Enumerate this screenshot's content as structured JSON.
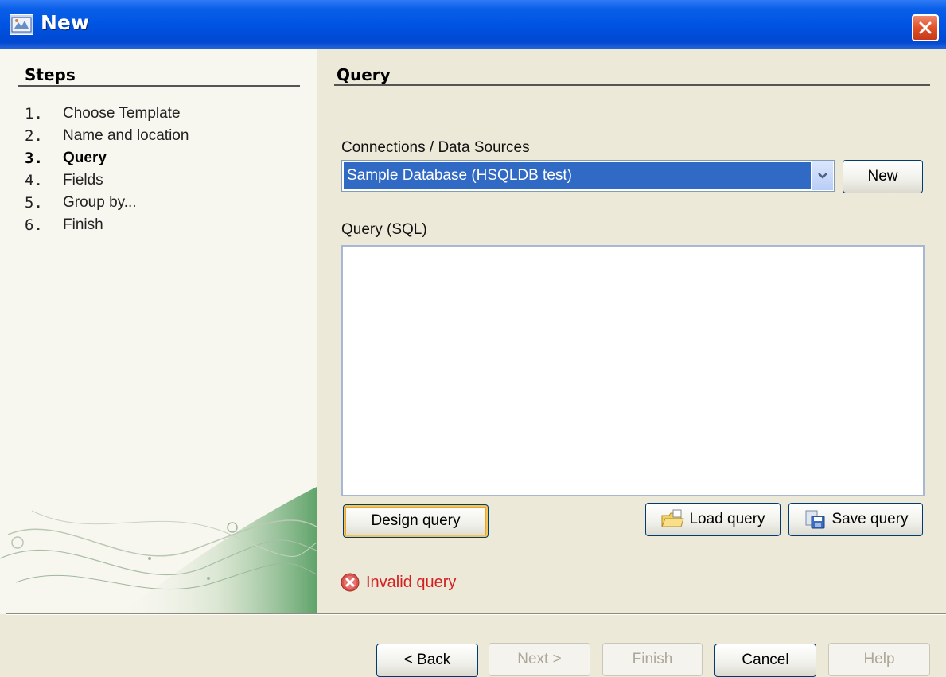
{
  "window": {
    "title": "New",
    "icon": "report-wizard-icon"
  },
  "steps": {
    "heading": "Steps",
    "items": [
      {
        "number": "1.",
        "label": "Choose Template",
        "current": false
      },
      {
        "number": "2.",
        "label": "Name and location",
        "current": false
      },
      {
        "number": "3.",
        "label": "Query",
        "current": true
      },
      {
        "number": "4.",
        "label": "Fields",
        "current": false
      },
      {
        "number": "5.",
        "label": "Group by...",
        "current": false
      },
      {
        "number": "6.",
        "label": "Finish",
        "current": false
      }
    ]
  },
  "query_panel": {
    "heading": "Query",
    "connections_label": "Connections / Data Sources",
    "connection_selected": "Sample Database (HSQLDB test)",
    "new_button": "New",
    "sql_label": "Query (SQL)",
    "sql_value": "",
    "design_button": "Design query",
    "load_button": "Load query",
    "save_button": "Save query",
    "status": "Invalid query"
  },
  "footer": {
    "back": "< Back",
    "next": "Next >",
    "finish": "Finish",
    "cancel": "Cancel",
    "help": "Help"
  },
  "colors": {
    "title_bar": "#0054e3",
    "selection": "#316ac5",
    "error": "#d32020",
    "dialog_background": "#ece9d8"
  }
}
